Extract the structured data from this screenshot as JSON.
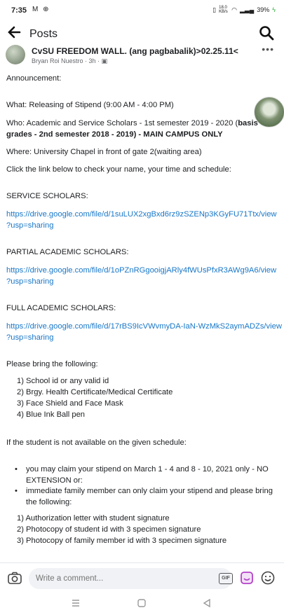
{
  "status_bar": {
    "time": "7:35",
    "left_icons": "M ⊕",
    "data_speed": "18.0 KB/s",
    "battery": "39%"
  },
  "app_bar": {
    "title": "Posts"
  },
  "post": {
    "group_name": "CvSU FREEDOM WALL. (ang pagbabalik)>02.25.11<",
    "author": "Bryan Roi Nuestro",
    "time_ago": "3h",
    "announcement": "Announcement:",
    "what": "What: Releasing of Stipend (9:00 AM - 4:00 PM)",
    "who_1a": "Who: Academic and Service Scholars - 1st semester 2019 - 2020 (",
    "who_1b": "basis of",
    "who_2a": "grades - 2nd semester 2018 - 2019)",
    "who_2b": " - MAIN CAMPUS ONLY",
    "where": "Where: University Chapel in front of gate 2(waiting area)",
    "click": "Click the link below to check your name, your time and schedule:",
    "service_heading": "SERVICE SCHOLARS:",
    "service_link_1": "https://drive.google.com/file/d/1suLUX2xgBxd6rz9zSZENp3KGyFU71Ttx/view",
    "service_link_2": "?usp=sharing",
    "partial_heading": "PARTIAL ACADEMIC SCHOLARS:",
    "partial_link_1": "https://drive.google.com/file/d/1oPZnRGgooigjARly4fWUsPfxR3AWg9A6/view",
    "partial_link_2": "?usp=sharing",
    "full_heading": "FULL ACADEMIC SCHOLARS:",
    "full_link_1": "https://drive.google.com/file/d/17rBS9IcVWvmyDA-IaN-WzMkS2aymADZs/view",
    "full_link_2": "?usp=sharing",
    "bring_heading": "Please bring the following:",
    "bring_items": [
      "1) School id or any valid id",
      "2) Brgy. Health Certificate/Medical Certificate",
      "3) Face Shield and Face Mask",
      "4) Blue Ink Ball pen"
    ],
    "unavailable": "If the student is not available on the given schedule:",
    "bullet_1a": "you may claim your stipend on March 1 - 4 and 8 - 10, 2021 only - NO",
    "bullet_1b": "EXTENSION or:",
    "bullet_2a": " immediate family member can only claim your stipend and please bring",
    "bullet_2b": "the following:",
    "claim_items": [
      "1) Authorization letter with student signature",
      "2) Photocopy of student id with  3 specimen signature",
      "3) Photocopy of family member id with 3 specimen signature"
    ]
  },
  "comment_bar": {
    "placeholder": "Write a comment...",
    "gif_label": "GIF"
  },
  "icons": {
    "back": "back-arrow-icon",
    "search": "search-icon",
    "more": "more-options-icon",
    "camera": "camera-icon",
    "gif": "gif-icon",
    "sticker": "sticker-icon",
    "emoji": "emoji-icon"
  },
  "colors": {
    "link": "#1877c8",
    "text": "#1c1e21",
    "meta": "#65676b",
    "comment_bg": "#f0f2f5"
  }
}
